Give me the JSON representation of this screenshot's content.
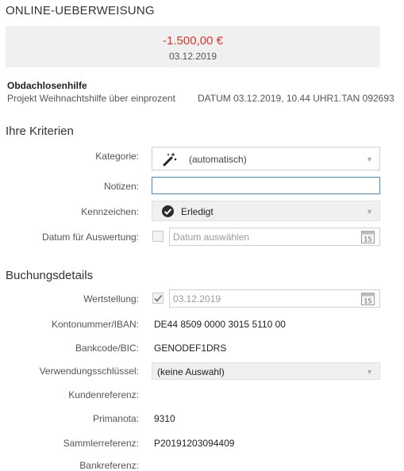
{
  "header": {
    "title": "ONLINE-UEBERWEISUNG"
  },
  "summary": {
    "amount": "-1.500,00 €",
    "date": "03.12.2019",
    "amount_color": "#d9372c"
  },
  "transaction": {
    "payee": "Obdachlosenhilfe",
    "purpose": "Projekt Weihnachtshilfe über einprozent",
    "reference": "DATUM 03.12.2019, 10.44 UHR1.TAN 092693"
  },
  "criteria": {
    "heading": "Ihre Kriterien",
    "category_label": "Kategorie:",
    "category_value": "(automatisch)",
    "category_icon": "magic-wand-icon",
    "notes_label": "Notizen:",
    "notes_value": "",
    "flag_label": "Kennzeichen:",
    "flag_value": "Erledigt",
    "flag_icon": "checkmark-circle-icon",
    "eval_date_label": "Datum für Auswertung:",
    "eval_date_placeholder": "Datum auswählen",
    "eval_date_checked": false,
    "calendar_day": "15"
  },
  "details": {
    "heading": "Buchungsdetails",
    "value_date_label": "Wertstellung:",
    "value_date": "03.12.2019",
    "value_date_checked": true,
    "iban_label": "Kontonummer/IBAN:",
    "iban": "DE44 8509 0000 3015 5110 00",
    "bic_label": "Bankcode/BIC:",
    "bic": "GENODEF1DRS",
    "key_label": "Verwendungsschlüssel:",
    "key_value": "(keine Auswahl)",
    "customer_ref_label": "Kundenreferenz:",
    "customer_ref": "",
    "primanota_label": "Primanota:",
    "primanota": "9310",
    "collective_ref_label": "Sammlerreferenz:",
    "collective_ref": "P20191203094409",
    "cut_label": "Bankreferenz:"
  }
}
